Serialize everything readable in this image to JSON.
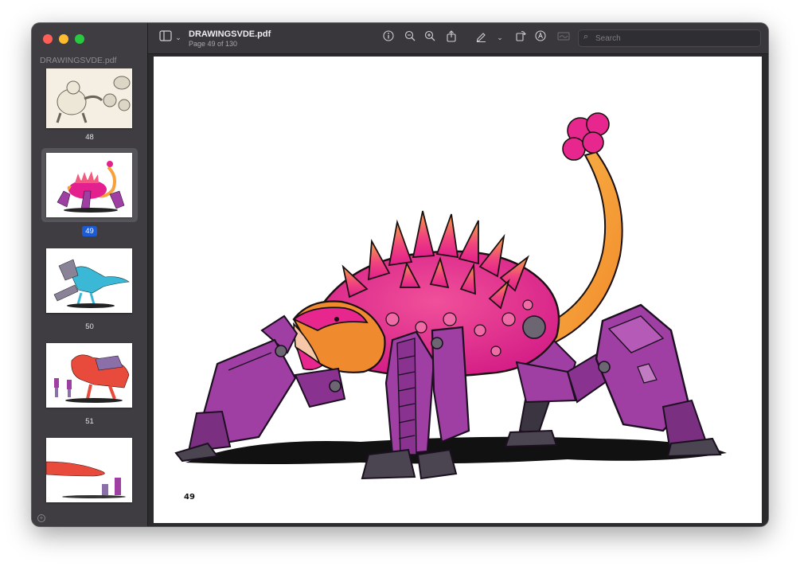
{
  "window": {
    "sidebar_title": "DRAWINGSVDE.pdf",
    "doc_title": "DRAWINGSVDE.pdf",
    "doc_subtitle": "Page 49 of 130",
    "search_placeholder": "Search"
  },
  "toolbar_icons": [
    "sidebar-icon",
    "chevron-down-icon",
    "info-icon",
    "zoom-out-icon",
    "zoom-in-icon",
    "share-icon",
    "highlight-icon",
    "chevron-down-icon",
    "rotate-icon",
    "markup-icon",
    "signature-icon"
  ],
  "thumbnails": [
    {
      "page": "48",
      "selected": false
    },
    {
      "page": "49",
      "selected": true
    },
    {
      "page": "50",
      "selected": false
    },
    {
      "page": "51",
      "selected": false
    }
  ],
  "page": {
    "number": "49"
  },
  "colors": {
    "accent": "#1b5bd6",
    "robot_purple": "#a03fa3",
    "creature_magenta": "#e4208f",
    "tail_orange": "#f6a13a"
  }
}
